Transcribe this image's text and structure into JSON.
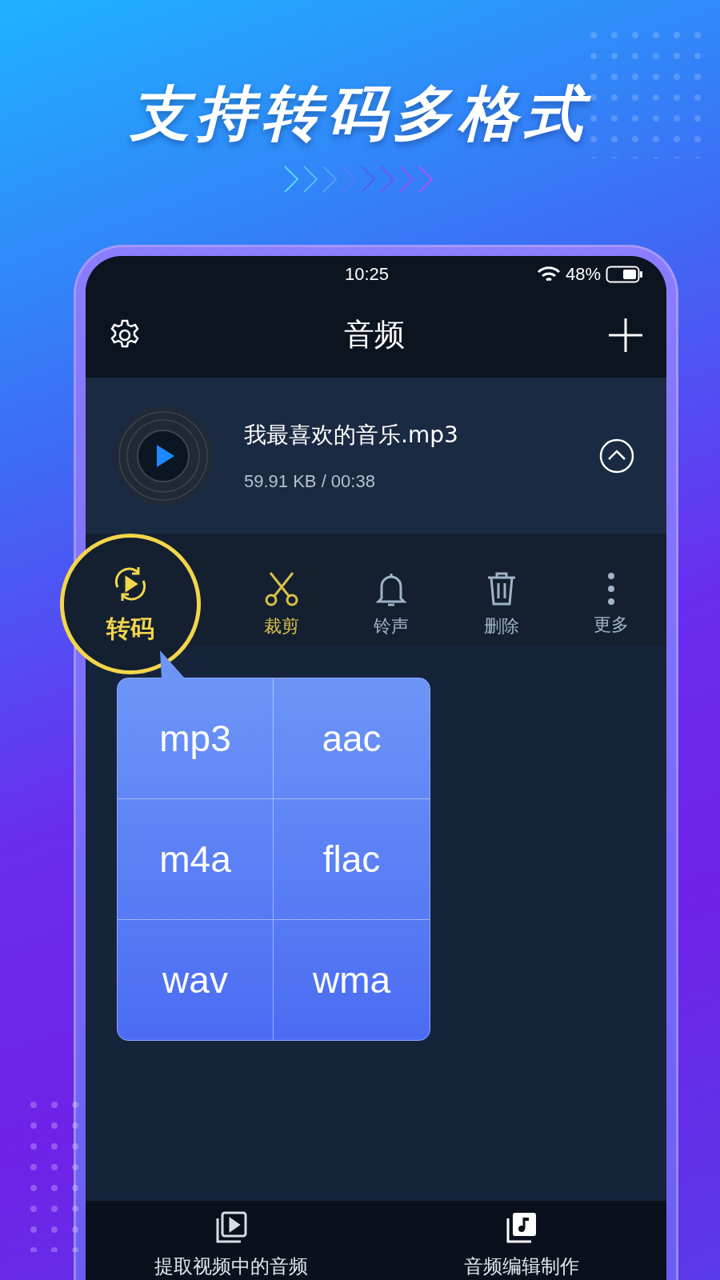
{
  "headline": "支持转码多格式",
  "status_bar": {
    "time": "10:25",
    "battery": "48%"
  },
  "header": {
    "title": "音频"
  },
  "file": {
    "name": "我最喜欢的音乐.mp3",
    "meta": "59.91 KB / 00:38"
  },
  "actions": [
    {
      "label": "转码",
      "kind": "convert",
      "selected": true,
      "color": "#f2d64b"
    },
    {
      "label": "裁剪",
      "kind": "cut",
      "selected": false,
      "color": "#d9bf4a"
    },
    {
      "label": "铃声",
      "kind": "ringtone",
      "selected": false,
      "color": "#9fb4c8"
    },
    {
      "label": "删除",
      "kind": "delete",
      "selected": false,
      "color": "#9fb4c8"
    },
    {
      "label": "更多",
      "kind": "more",
      "selected": false,
      "color": "#9fb4c8"
    }
  ],
  "formats": [
    "mp3",
    "aac",
    "m4a",
    "flac",
    "wav",
    "wma"
  ],
  "bottom_nav": [
    {
      "label": "提取视频中的音频",
      "kind": "video"
    },
    {
      "label": "音频编辑制作",
      "kind": "audio"
    }
  ]
}
